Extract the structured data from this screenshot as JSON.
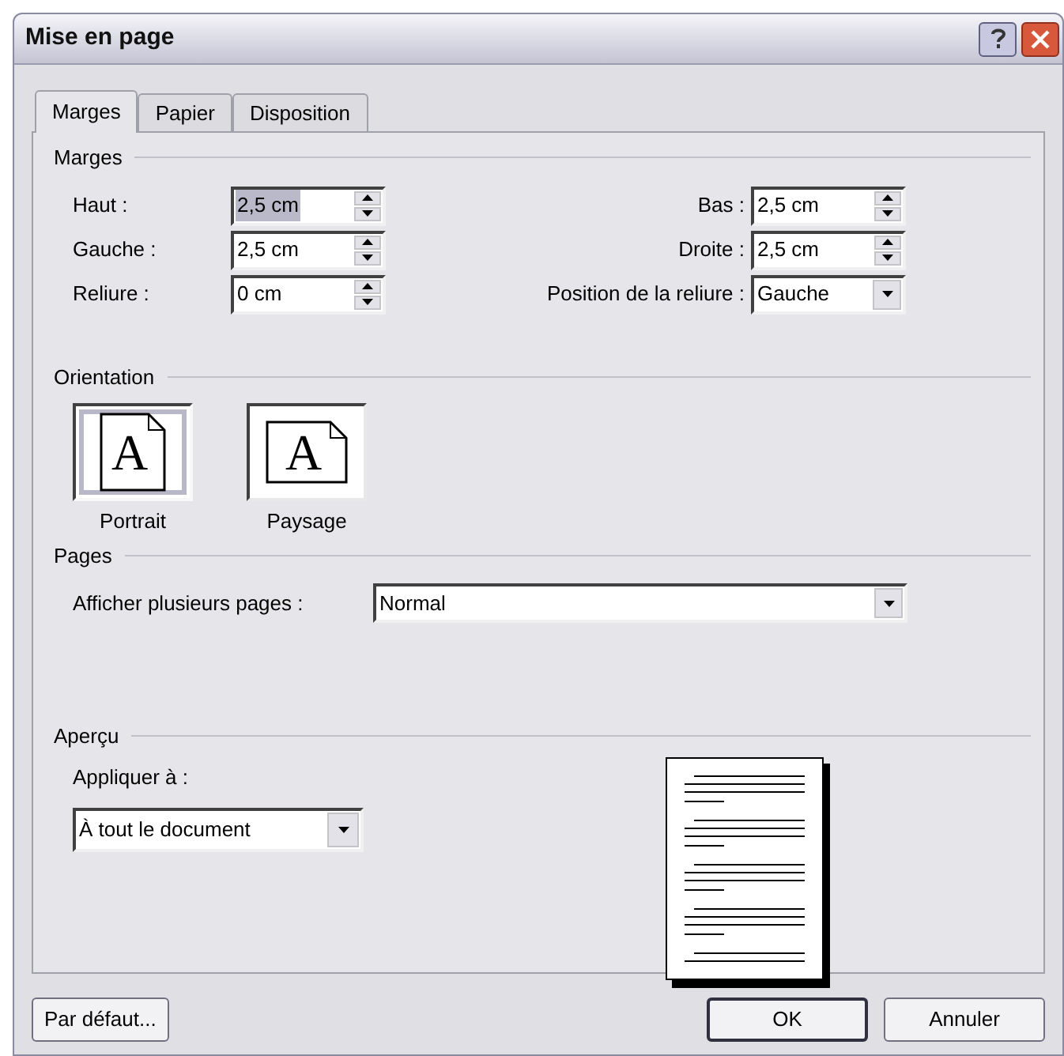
{
  "window": {
    "title": "Mise en page"
  },
  "tabs": [
    {
      "label": "Marges",
      "selected": true
    },
    {
      "label": "Papier",
      "selected": false
    },
    {
      "label": "Disposition",
      "selected": false
    }
  ],
  "margins": {
    "heading": "Marges",
    "left": [
      {
        "label": "Haut :",
        "value": "2,5 cm",
        "kind": "spin",
        "selected": true
      },
      {
        "label": "Gauche :",
        "value": "2,5 cm",
        "kind": "spin",
        "selected": false
      },
      {
        "label": "Reliure :",
        "value": "0 cm",
        "kind": "spin",
        "selected": false
      }
    ],
    "right": [
      {
        "label": "Bas :",
        "value": "2,5 cm",
        "kind": "spin",
        "selected": false
      },
      {
        "label": "Droite :",
        "value": "2,5 cm",
        "kind": "spin",
        "selected": false
      },
      {
        "label": "Position de la reliure :",
        "value": "Gauche",
        "kind": "dropdown",
        "selected": false
      }
    ]
  },
  "orientation": {
    "heading": "Orientation",
    "options": [
      {
        "label": "Portrait",
        "glyph": "A",
        "kind": "portrait",
        "selected": true
      },
      {
        "label": "Paysage",
        "glyph": "A",
        "kind": "landscape",
        "selected": false
      }
    ]
  },
  "pages": {
    "heading": "Pages",
    "label": "Afficher plusieurs pages :",
    "value": "Normal"
  },
  "preview": {
    "heading": "Aperçu",
    "apply_label": "Appliquer à :",
    "apply_value": "À tout le document"
  },
  "buttons": [
    {
      "label": "Par défaut...",
      "default": false
    },
    {
      "label": "OK",
      "default": true
    },
    {
      "label": "Annuler",
      "default": false
    }
  ]
}
